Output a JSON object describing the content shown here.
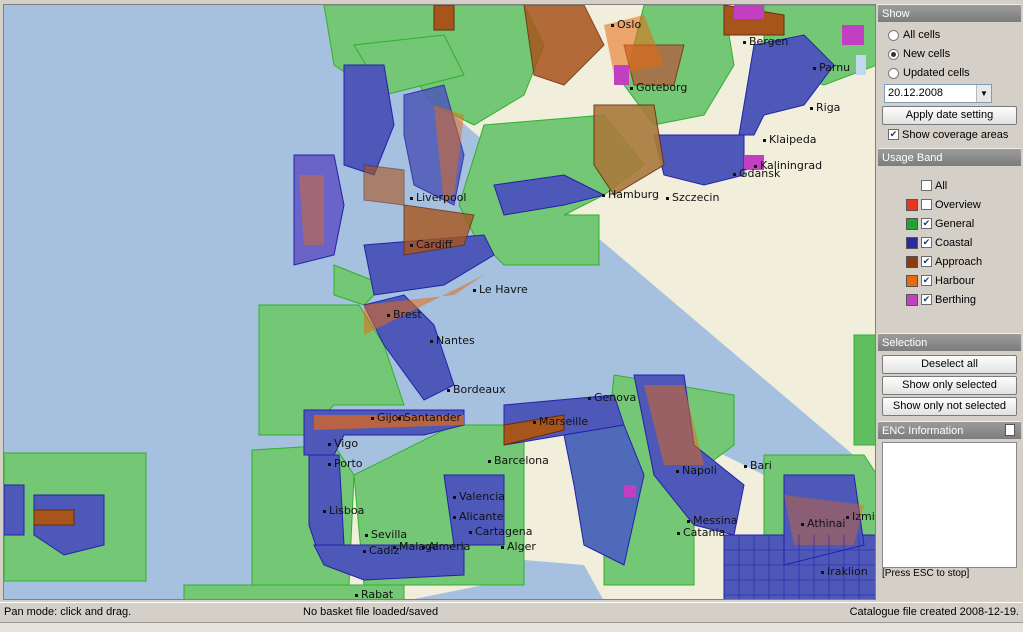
{
  "map": {
    "cities": [
      "Oslo",
      "Goteborg",
      "Parnu",
      "Riga",
      "Klaipeda",
      "Kaliningrad",
      "Gdansk",
      "Szczecin",
      "Hamburg",
      "Liverpool",
      "Cardiff",
      "Le Havre",
      "Brest",
      "Nantes",
      "Bordeaux",
      "Gijon",
      "Santander",
      "Vigo",
      "Porto",
      "Lisboa",
      "Sevilla",
      "Cadiz",
      "Malaga",
      "Almeria",
      "Alicante",
      "Valencia",
      "Cartagena",
      "Barcelona",
      "Marseille",
      "Genova",
      "Napoli",
      "Bari",
      "Messina",
      "Catania",
      "Alger",
      "Rabat",
      "Izmir",
      "Athinai",
      "Iraklion",
      "Bergen"
    ]
  },
  "panel": {
    "show": {
      "title": "Show",
      "options": [
        "All cells",
        "New cells",
        "Updated cells"
      ],
      "selected": "New cells",
      "date": "20.12.2008",
      "apply_label": "Apply date setting",
      "coverage_label": "Show coverage areas",
      "coverage_checked": true
    },
    "usage": {
      "title": "Usage Band",
      "all_label": "All",
      "bands": [
        {
          "label": "Overview",
          "color": "#e8351e",
          "checked": false
        },
        {
          "label": "General",
          "color": "#22a12e",
          "checked": true
        },
        {
          "label": "Coastal",
          "color": "#2a2aa0",
          "checked": true
        },
        {
          "label": "Approach",
          "color": "#8e3a10",
          "checked": true
        },
        {
          "label": "Harbour",
          "color": "#e56a12",
          "checked": true
        },
        {
          "label": "Berthing",
          "color": "#c23fc2",
          "checked": true
        }
      ]
    },
    "selection": {
      "title": "Selection",
      "deselect": "Deselect all",
      "only_selected": "Show only selected",
      "only_not_selected": "Show only not selected"
    },
    "enc": {
      "title": "ENC Information",
      "esc_hint": "[Press ESC to stop]"
    }
  },
  "status": {
    "mode": "Pan mode: click and drag.",
    "basket": "No basket file loaded/saved",
    "catalogue": "Catalogue file created 2008-12-19."
  }
}
